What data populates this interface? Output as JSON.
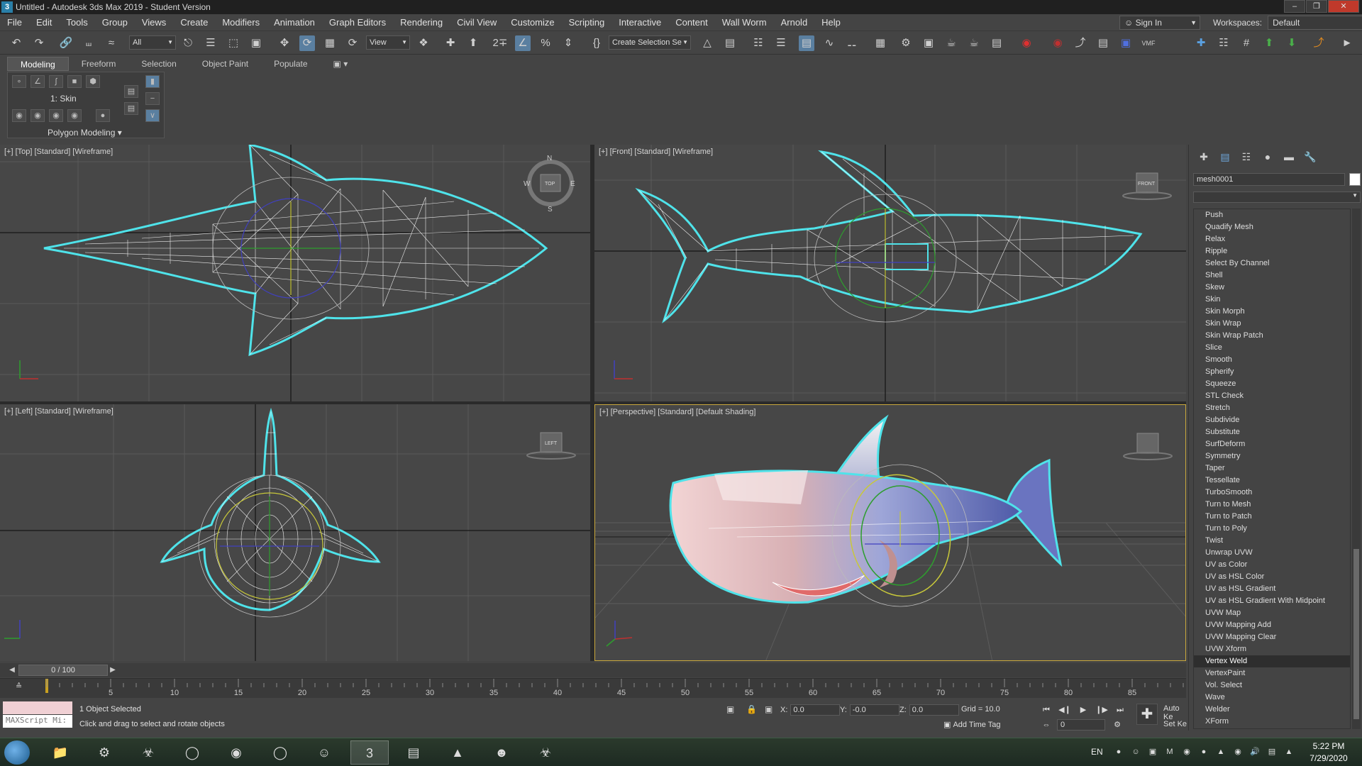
{
  "titlebar": {
    "title": "Untitled - Autodesk 3ds Max 2019 - Student Version",
    "app_icon": "3"
  },
  "menubar": {
    "items": [
      "File",
      "Edit",
      "Tools",
      "Group",
      "Views",
      "Create",
      "Modifiers",
      "Animation",
      "Graph Editors",
      "Rendering",
      "Civil View",
      "Customize",
      "Scripting",
      "Interactive",
      "Content",
      "Wall Worm",
      "Arnold",
      "Help"
    ],
    "signin_label": "Sign In",
    "workspaces_label": "Workspaces:",
    "workspaces_value": "Default"
  },
  "toolbar": {
    "selection_filter": "All",
    "reference_coord": "View",
    "named_selection": "Create Selection Se"
  },
  "ribbon": {
    "tabs": [
      "Modeling",
      "Freeform",
      "Selection",
      "Object Paint",
      "Populate"
    ],
    "active_tab": "Modeling",
    "modifier_label": "1: Skin",
    "panel_label": "Polygon Modeling"
  },
  "viewports": {
    "top": {
      "label": "[+] [Top] [Standard] [Wireframe]",
      "viewcube": "TOP"
    },
    "front": {
      "label": "[+] [Front] [Standard] [Wireframe]",
      "viewcube": "FRONT"
    },
    "left": {
      "label": "[+] [Left] [Standard] [Wireframe]",
      "viewcube": "LEFT"
    },
    "perspective": {
      "label": "[+] [Perspective] [Standard] [Default Shading]"
    },
    "compass": {
      "n": "N",
      "s": "S",
      "e": "E",
      "w": "W"
    }
  },
  "command_panel": {
    "object_name": "mesh0001",
    "modifiers": [
      "Push",
      "Quadify Mesh",
      "Relax",
      "Ripple",
      "Select By Channel",
      "Shell",
      "Skew",
      "Skin",
      "Skin Morph",
      "Skin Wrap",
      "Skin Wrap Patch",
      "Slice",
      "Smooth",
      "Spherify",
      "Squeeze",
      "STL Check",
      "Stretch",
      "Subdivide",
      "Substitute",
      "SurfDeform",
      "Symmetry",
      "Taper",
      "Tessellate",
      "TurboSmooth",
      "Turn to Mesh",
      "Turn to Patch",
      "Turn to Poly",
      "Twist",
      "Unwrap UVW",
      "UV as Color",
      "UV as HSL Color",
      "UV as HSL Gradient",
      "UV as HSL Gradient With Midpoint",
      "UVW Map",
      "UVW Mapping Add",
      "UVW Mapping Clear",
      "UVW Xform",
      "Vertex Weld",
      "VertexPaint",
      "Vol. Select",
      "Wave",
      "Welder",
      "XForm"
    ],
    "selected_modifier": "Vertex Weld"
  },
  "timeline": {
    "slider_label": "0 / 100",
    "ticks": [
      "5",
      "10",
      "15",
      "20",
      "25",
      "30",
      "35",
      "40",
      "45",
      "50",
      "55",
      "60",
      "65",
      "70",
      "75",
      "80",
      "85"
    ]
  },
  "statusbar": {
    "maxscript": "MAXScript Mi:",
    "selected": "1 Object Selected",
    "prompt": "Click and drag to select and rotate objects",
    "x_label": "X:",
    "x_value": "0.0",
    "y_label": "Y:",
    "y_value": "-0.0",
    "z_label": "Z:",
    "z_value": "0.0",
    "grid": "Grid = 10.0",
    "add_time_tag": "Add Time Tag",
    "frame": "0",
    "auto_key": "Auto Ke",
    "set_key": "Set Ke"
  },
  "taskbar": {
    "lang": "EN",
    "time": "5:22 PM",
    "date": "7/29/2020"
  },
  "colors": {
    "selection_outline": "#4fe3ea",
    "active_viewport_border": "#c9a83c",
    "wireframe": "#ffffff"
  }
}
